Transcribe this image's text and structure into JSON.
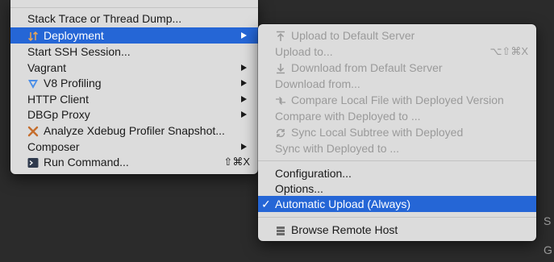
{
  "main_menu": {
    "items": [
      {
        "label": "Stack Trace or Thread Dump..."
      },
      {
        "label": "Deployment"
      },
      {
        "label": "Start SSH Session..."
      },
      {
        "label": "Vagrant"
      },
      {
        "label": "V8 Profiling"
      },
      {
        "label": "HTTP Client"
      },
      {
        "label": "DBGp Proxy"
      },
      {
        "label": "Analyze Xdebug Profiler Snapshot..."
      },
      {
        "label": "Composer"
      },
      {
        "label": "Run Command...",
        "shortcut": "⇧⌘X"
      }
    ]
  },
  "deployment_submenu": {
    "items": [
      {
        "label": "Upload to Default Server"
      },
      {
        "label": "Upload to...",
        "shortcut": "⌥⇧⌘X"
      },
      {
        "label": "Download from Default Server"
      },
      {
        "label": "Download from..."
      },
      {
        "label": "Compare Local File with Deployed Version"
      },
      {
        "label": "Compare with Deployed to ..."
      },
      {
        "label": "Sync Local Subtree with Deployed"
      },
      {
        "label": "Sync with Deployed to ..."
      },
      {
        "label": "Configuration..."
      },
      {
        "label": "Options..."
      },
      {
        "label": "Automatic Upload (Always)",
        "check": "✓"
      },
      {
        "label": "Browse Remote Host"
      }
    ]
  },
  "background": {
    "edge_letters": [
      "S",
      "G"
    ]
  },
  "colors": {
    "selection": "#2566d6",
    "menu_bg": "#dcdcdc",
    "disabled_text": "#9a9a9a"
  }
}
